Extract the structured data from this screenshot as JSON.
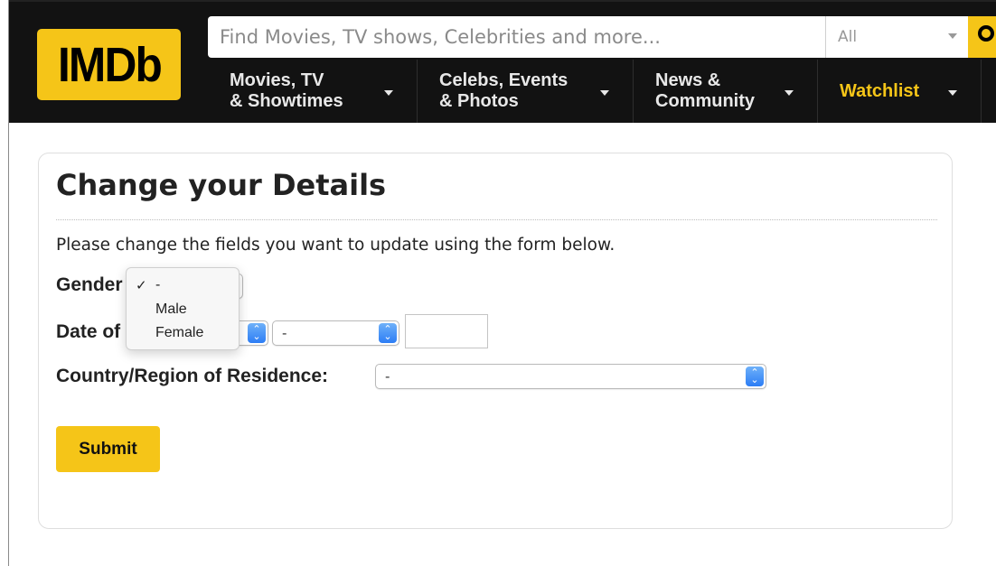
{
  "header": {
    "logo_text": "IMDb",
    "search_placeholder": "Find Movies, TV shows, Celebrities and more...",
    "search_category": "All",
    "nav": [
      {
        "label": "Movies, TV\n& Showtimes"
      },
      {
        "label": "Celebs, Events\n& Photos"
      },
      {
        "label": "News &\nCommunity"
      },
      {
        "label": "Watchlist"
      }
    ]
  },
  "form": {
    "title": "Change your Details",
    "instructions": "Please change the fields you want to update using the form below.",
    "gender_label": "Gender",
    "dob_label": "Date of",
    "country_label": "Country/Region of Residence:",
    "dob_month_value": "-",
    "country_value": "-",
    "submit_label": "Submit"
  },
  "gender_dropdown": {
    "options": [
      "-",
      "Male",
      "Female"
    ],
    "selected": "-",
    "check_mark": "✓"
  },
  "colors": {
    "brand_yellow": "#f5c518",
    "header_bg": "#121212",
    "stepper_blue": "#2c7df5"
  }
}
